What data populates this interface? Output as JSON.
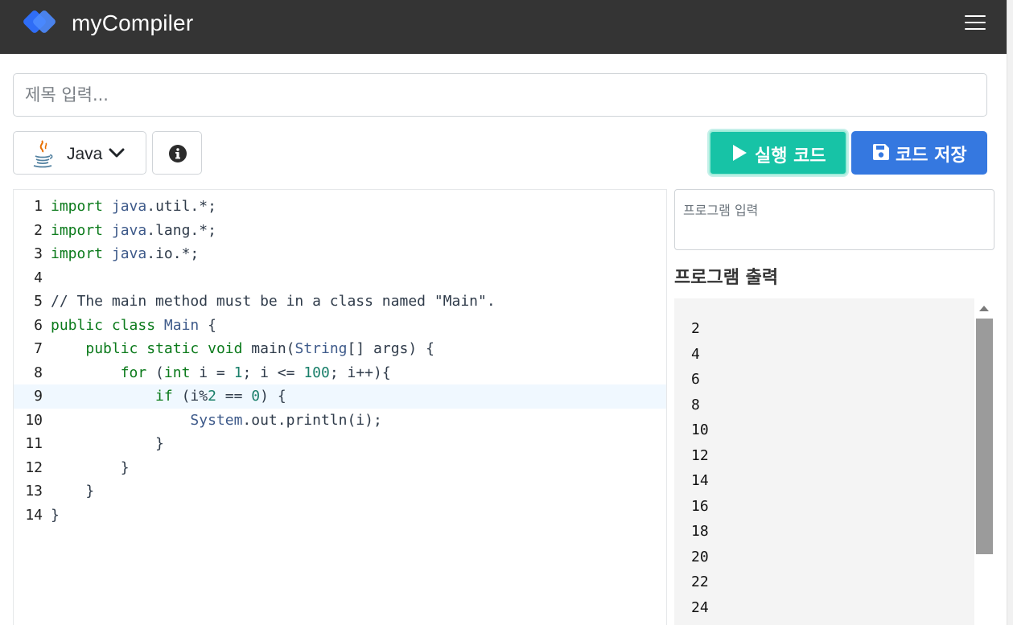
{
  "header": {
    "brand": "myCompiler"
  },
  "title_field": {
    "placeholder": "제목 입력...",
    "value": ""
  },
  "toolbar": {
    "language": "Java",
    "run_label": "실행 코드",
    "save_label": "코드 저장"
  },
  "colors": {
    "navbar": "#343434",
    "run_button": "#17c3a6",
    "save_button": "#3578e0",
    "logo_blue": "#2f6df6"
  },
  "editor": {
    "active_line": 9,
    "lines": [
      {
        "no": "1",
        "text": "import java.util.*;"
      },
      {
        "no": "2",
        "text": "import java.lang.*;"
      },
      {
        "no": "3",
        "text": "import java.io.*;"
      },
      {
        "no": "4",
        "text": ""
      },
      {
        "no": "5",
        "text": "// The main method must be in a class named \"Main\"."
      },
      {
        "no": "6",
        "text": "public class Main {"
      },
      {
        "no": "7",
        "text": "    public static void main(String[] args) {"
      },
      {
        "no": "8",
        "text": "        for (int i = 1; i <= 100; i++){"
      },
      {
        "no": "9",
        "text": "            if (i%2 == 0) {"
      },
      {
        "no": "10",
        "text": "                System.out.println(i);"
      },
      {
        "no": "11",
        "text": "            }"
      },
      {
        "no": "12",
        "text": "        }"
      },
      {
        "no": "13",
        "text": "    }"
      },
      {
        "no": "14",
        "text": "}"
      }
    ]
  },
  "program_input": {
    "placeholder": "프로그램 입력",
    "value": ""
  },
  "output": {
    "title": "프로그램 출력",
    "lines": [
      "2",
      "4",
      "6",
      "8",
      "10",
      "12",
      "14",
      "16",
      "18",
      "20",
      "22",
      "24"
    ]
  }
}
